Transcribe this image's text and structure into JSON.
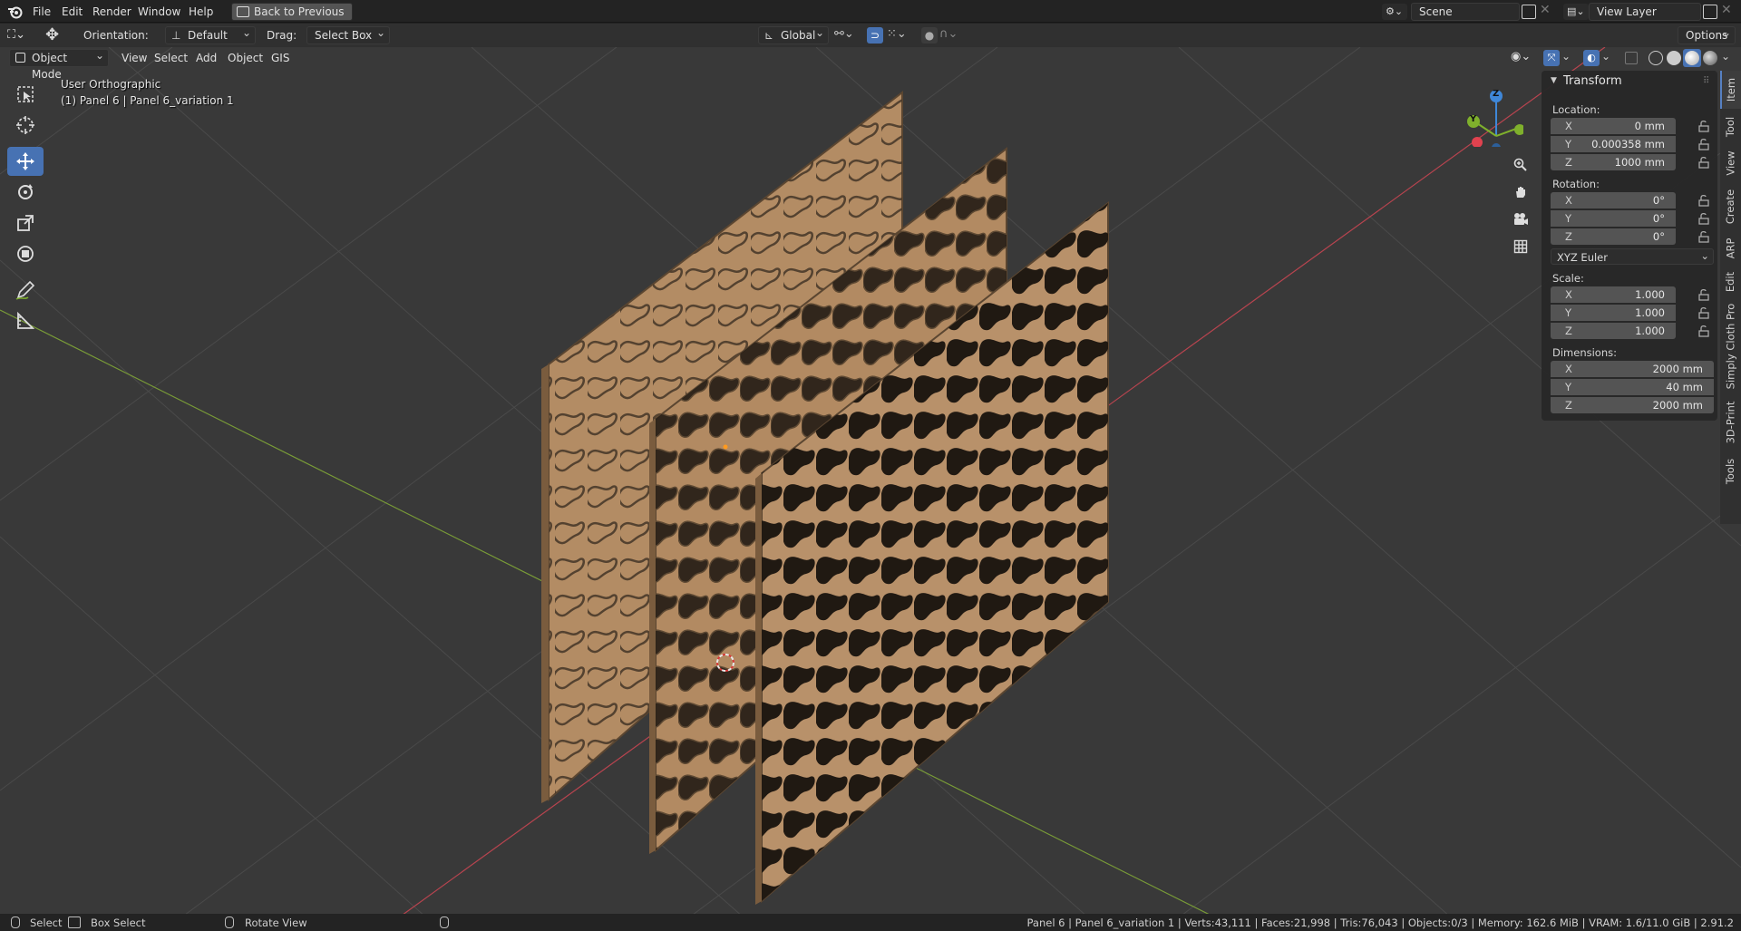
{
  "menu": {
    "items": [
      "File",
      "Edit",
      "Render",
      "Window",
      "Help"
    ],
    "back_button": "Back to Previous",
    "scene_label": "Scene",
    "view_layer_label": "View Layer"
  },
  "tool_header": {
    "orientation_label": "Orientation:",
    "orientation_value": "Default",
    "drag_label": "Drag:",
    "drag_value": "Select Box",
    "transform_orientation": "Global",
    "options_label": "Options"
  },
  "viewport_header": {
    "mode": "Object Mode",
    "menus": [
      "View",
      "Select",
      "Add",
      "Object",
      "GIS"
    ]
  },
  "viewport": {
    "view_name": "User Orthographic",
    "object_info": "(1) Panel 6 | Panel 6_variation 1"
  },
  "gizmo": {
    "x": "X",
    "y": "Y",
    "z": "Z"
  },
  "transform_panel": {
    "title": "Transform",
    "location_label": "Location:",
    "location": [
      {
        "axis": "X",
        "value": "0 mm"
      },
      {
        "axis": "Y",
        "value": "0.000358 mm"
      },
      {
        "axis": "Z",
        "value": "1000 mm"
      }
    ],
    "rotation_label": "Rotation:",
    "rotation": [
      {
        "axis": "X",
        "value": "0°"
      },
      {
        "axis": "Y",
        "value": "0°"
      },
      {
        "axis": "Z",
        "value": "0°"
      }
    ],
    "rotation_mode": "XYZ Euler",
    "scale_label": "Scale:",
    "scale": [
      {
        "axis": "X",
        "value": "1.000"
      },
      {
        "axis": "Y",
        "value": "1.000"
      },
      {
        "axis": "Z",
        "value": "1.000"
      }
    ],
    "dimensions_label": "Dimensions:",
    "dimensions": [
      {
        "axis": "X",
        "value": "2000 mm"
      },
      {
        "axis": "Y",
        "value": "40 mm"
      },
      {
        "axis": "Z",
        "value": "2000 mm"
      }
    ]
  },
  "sidebar_tabs": [
    "Item",
    "Tool",
    "View",
    "Create",
    "ARP",
    "Edit",
    "Simply Cloth Pro",
    "3D-Print",
    "Tools"
  ],
  "status_bar": {
    "select": "Select",
    "box_select": "Box Select",
    "rotate_view": "Rotate View",
    "stats": "Panel 6 | Panel 6_variation 1 | Verts:43,111 | Faces:21,998 | Tris:76,043 | Objects:0/3 | Memory: 162.6 MiB | VRAM: 1.6/11.0 GiB | 2.91.2"
  },
  "colors": {
    "accent": "#4772b3",
    "axis_x": "#e0424f",
    "axis_y": "#7fb02c",
    "axis_z": "#3f87d8",
    "wood": "#b7916a"
  }
}
